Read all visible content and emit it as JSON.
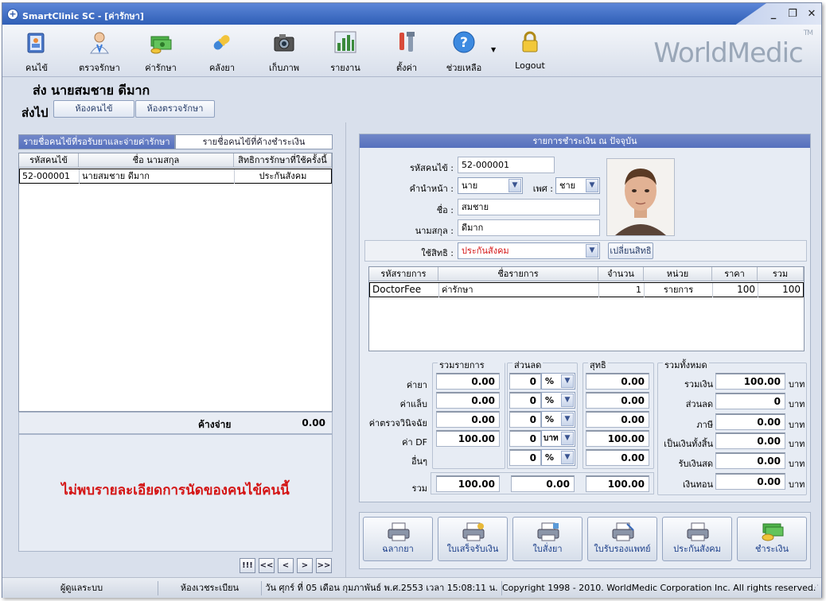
{
  "window": {
    "title": "SmartClinic SC - [ค่ารักษา]",
    "min": "_",
    "restore": "❐",
    "close": "✕"
  },
  "toolbar": {
    "items": [
      {
        "label": "คนไข้",
        "icon": "patient-book-icon"
      },
      {
        "label": "ตรวจรักษา",
        "icon": "doctor-icon"
      },
      {
        "label": "ค่ารักษา",
        "icon": "money-icon"
      },
      {
        "label": "คลังยา",
        "icon": "pill-icon"
      },
      {
        "label": "เก็บภาพ",
        "icon": "camera-icon"
      },
      {
        "label": "รายงาน",
        "icon": "chart-icon"
      },
      {
        "label": "ตั้งค่า",
        "icon": "tools-icon"
      },
      {
        "label": "ช่วยเหลือ",
        "icon": "help-icon"
      },
      {
        "label": "Logout",
        "icon": "lock-icon"
      }
    ],
    "logo": "WorldMedic",
    "logo_tm": "TM"
  },
  "header": {
    "patient": "ส่ง นายสมชาย ดีมาก",
    "sendto": "ส่งไป",
    "btn_patient_room": "ห้องคนไข้",
    "btn_exam_room": "ห้องตรวจรักษา"
  },
  "left": {
    "tab1": "รายชื่อคนไข้ที่รอรับยาและจ่ายค่ารักษา",
    "tab2": "รายชื่อคนไข้ที่ค้างชำระเงิน",
    "columns": [
      "รหัสคนไข้",
      "ชื่อ นามสกุล",
      "สิทธิการรักษาที่ใช้ครั้งนี้"
    ],
    "rows": [
      [
        "52-000001",
        "นายสมชาย ดีมาก",
        "ประกันสังคม"
      ]
    ],
    "outstanding_label": "ค้างจ่าย",
    "outstanding_value": "0.00",
    "no_appointment": "ไม่พบรายละเอียดการนัดของคนไข้คนนี้",
    "nav": [
      "!!!",
      "<<",
      "<",
      ">",
      ">>"
    ]
  },
  "right": {
    "title": "รายการชำระเงิน ณ ปัจจุบัน",
    "labels": {
      "hn": "รหัสคนไข้ :",
      "prefix": "คำนำหน้า :",
      "sex": "เพศ :",
      "name": "ชื่อ :",
      "surname": "นามสกุล :",
      "right": "ใช้สิทธิ :"
    },
    "values": {
      "hn": "52-000001",
      "prefix": "นาย",
      "sex": "ชาย",
      "name": "สมชาย",
      "surname": "ดีมาก",
      "right": "ประกันสังคม"
    },
    "change_right_btn": "เปลี่ยนสิทธิ",
    "items_columns": [
      "รหัสรายการ",
      "ชื่อรายการ",
      "จำนวน",
      "หน่วย",
      "ราคา",
      "รวม"
    ],
    "items_rows": [
      [
        "DoctorFee",
        "ค่ารักษา",
        "1",
        "รายการ",
        "100",
        "100"
      ]
    ],
    "summary": {
      "group_treat": "รวมรายการรักษา",
      "group_discount": "ส่วนลด",
      "group_net": "สุทธิ",
      "group_total": "รวมทั้งหมด",
      "row_labels": [
        "ค่ายา",
        "ค่าแล็บ",
        "ค่าตรวจวินิจฉัย",
        "ค่า DF",
        "อื่นๆ"
      ],
      "treat": [
        "0.00",
        "0.00",
        "0.00",
        "100.00"
      ],
      "disc": [
        "0",
        "0",
        "0",
        "0",
        "0"
      ],
      "disc_unit": [
        "%",
        "%",
        "%",
        "บาท",
        "%"
      ],
      "net": [
        "0.00",
        "0.00",
        "0.00",
        "100.00",
        "0.00"
      ],
      "sum_label": "รวม",
      "sum_treat": "100.00",
      "sum_disc": "0.00",
      "sum_net": "100.00",
      "total_labels": [
        "รวมเงิน",
        "ส่วนลด",
        "ภาษี",
        "เป็นเงินทั้งสิ้น",
        "รับเงินสด",
        "เงินทอน"
      ],
      "total_values": [
        "100.00",
        "0",
        "0.00",
        "0.00",
        "0.00",
        "0.00"
      ],
      "baht": "บาท"
    },
    "buttons": [
      "ฉลากยา",
      "ใบเสร็จรับเงิน",
      "ใบสั่งยา",
      "ใบรับรองแพทย์",
      "ประกันสังคม",
      "ชำระเงิน"
    ]
  },
  "status": {
    "user": "ผู้ดูแลระบบ",
    "room": "ห้องเวชระเบียน",
    "datetime": "วัน ศุกร์ ที่ 05 เดือน กุมภาพันธ์ พ.ศ.2553 เวลา 15:08:11 น.",
    "copyright": "Copyright 1998 - 2010. WorldMedic Corporation Inc. All rights reserved."
  }
}
